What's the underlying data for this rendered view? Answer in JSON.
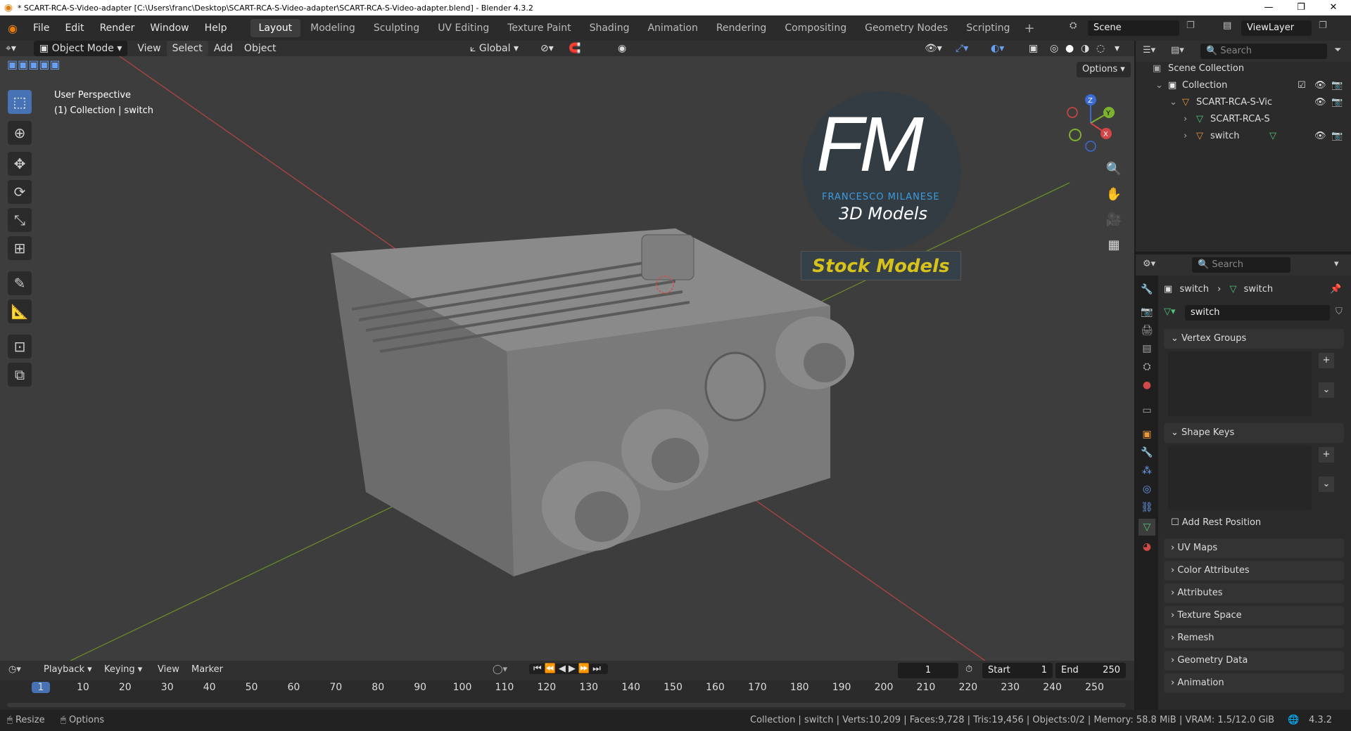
{
  "titlebar": {
    "text": "* SCART-RCA-S-Video-adapter [C:\\Users\\franc\\Desktop\\SCART-RCA-S-Video-adapter\\SCART-RCA-S-Video-adapter.blend] - Blender 4.3.2"
  },
  "menu": [
    "File",
    "Edit",
    "Render",
    "Window",
    "Help"
  ],
  "workspaces": [
    "Layout",
    "Modeling",
    "Sculpting",
    "UV Editing",
    "Texture Paint",
    "Shading",
    "Animation",
    "Rendering",
    "Compositing",
    "Geometry Nodes",
    "Scripting"
  ],
  "scene": "Scene",
  "view_layer": "ViewLayer",
  "viewport_header": {
    "mode": "Object Mode",
    "view": "View",
    "select": "Select",
    "add": "Add",
    "object": "Object",
    "transform": "Global",
    "options": "Options"
  },
  "viewport": {
    "line1": "User Perspective",
    "line2": "(1) Collection | switch"
  },
  "logo": {
    "initials": "FM",
    "name": "FRANCESCO MILANESE",
    "sub": "3D Models",
    "banner": "Stock Models"
  },
  "gizmo": {
    "x": "X",
    "y": "Y",
    "z": "Z"
  },
  "outliner": {
    "search": "Search",
    "scene_collection": "Scene Collection",
    "collection": "Collection",
    "obj1": "SCART-RCA-S-Vic",
    "mesh1": "SCART-RCA-S",
    "obj2": "switch"
  },
  "props": {
    "search": "Search",
    "crumb1": "switch",
    "crumb2": "switch",
    "datablock": "switch",
    "vertex_groups": "Vertex Groups",
    "shape_keys": "Shape Keys",
    "add_rest": "Add Rest Position",
    "uv_maps": "UV Maps",
    "color_attributes": "Color Attributes",
    "attributes": "Attributes",
    "texture_space": "Texture Space",
    "remesh": "Remesh",
    "geometry_data": "Geometry Data",
    "animation": "Animation"
  },
  "timeline": {
    "playback": "Playback",
    "keying": "Keying",
    "view": "View",
    "marker": "Marker",
    "frame": "1",
    "start_label": "Start",
    "start": "1",
    "end_label": "End",
    "end": "250",
    "ticks": [
      "1",
      "10",
      "20",
      "30",
      "40",
      "50",
      "60",
      "70",
      "80",
      "90",
      "100",
      "110",
      "120",
      "130",
      "140",
      "150",
      "160",
      "170",
      "180",
      "190",
      "200",
      "210",
      "220",
      "230",
      "240",
      "250"
    ]
  },
  "status": {
    "resize": "Resize",
    "options": "Options",
    "info": "Collection | switch | Verts:10,209 | Faces:9,728 | Tris:19,456 | Objects:0/2 | Memory: 58.8 MiB | VRAM: 1.5/12.0 GiB",
    "version": "4.3.2"
  }
}
